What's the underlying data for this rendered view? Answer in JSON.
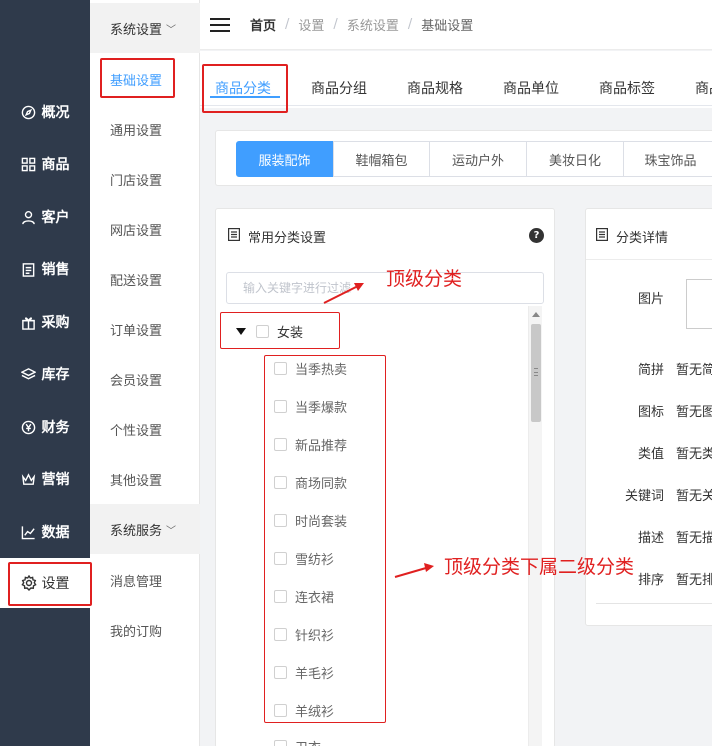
{
  "sidebar": {
    "items": [
      {
        "label": "概况",
        "icon": "compass-icon"
      },
      {
        "label": "商品",
        "icon": "grid-icon"
      },
      {
        "label": "客户",
        "icon": "user-icon"
      },
      {
        "label": "销售",
        "icon": "clipboard-icon"
      },
      {
        "label": "采购",
        "icon": "gift-icon"
      },
      {
        "label": "库存",
        "icon": "layers-icon"
      },
      {
        "label": "财务",
        "icon": "yen-icon"
      },
      {
        "label": "营销",
        "icon": "crown-icon"
      },
      {
        "label": "数据",
        "icon": "chart-icon"
      },
      {
        "label": "设置",
        "icon": "gear-icon"
      }
    ],
    "active_index": 9
  },
  "submenu": {
    "group1": "系统设置",
    "items1": [
      "基础设置",
      "通用设置",
      "门店设置",
      "网店设置",
      "配送设置",
      "订单设置",
      "会员设置",
      "个性设置",
      "其他设置"
    ],
    "group2": "系统服务",
    "items2": [
      "消息管理",
      "我的订购"
    ]
  },
  "breadcrumb": {
    "items": [
      "首页",
      "设置",
      "系统设置",
      "基础设置"
    ],
    "separator": "/"
  },
  "tabs": {
    "items": [
      "商品分类",
      "商品分组",
      "商品规格",
      "商品单位",
      "商品标签",
      "商品"
    ],
    "active": "商品分类"
  },
  "chips": {
    "items": [
      "服装配饰",
      "鞋帽箱包",
      "运动户外",
      "美妆日化",
      "珠宝饰品"
    ],
    "active": "服装配饰"
  },
  "left_card": {
    "title": "常用分类设置",
    "help": "?",
    "search_placeholder": "输入关键字进行过滤",
    "root": "女装",
    "children": [
      "当季热卖",
      "当季爆款",
      "新品推荐",
      "商场同款",
      "时尚套装",
      "雪纺衫",
      "连衣裙",
      "针织衫",
      "羊毛衫",
      "羊绒衫",
      "卫衣"
    ]
  },
  "right_card": {
    "title": "分类详情",
    "fields": [
      {
        "label": "图片",
        "value": ""
      },
      {
        "label": "简拼",
        "value": "暂无简"
      },
      {
        "label": "图标",
        "value": "暂无图"
      },
      {
        "label": "类值",
        "value": "暂无类"
      },
      {
        "label": "关键词",
        "value": "暂无关"
      },
      {
        "label": "描述",
        "value": "暂无描"
      },
      {
        "label": "排序",
        "value": "暂无排"
      }
    ]
  },
  "annotations": {
    "top_category": "顶级分类",
    "sub_category": "顶级分类下属二级分类",
    "color": "#e02020"
  },
  "colors": {
    "accent": "#409eff",
    "sidebar_bg": "#2f3a4b",
    "annotation": "#e02020"
  }
}
